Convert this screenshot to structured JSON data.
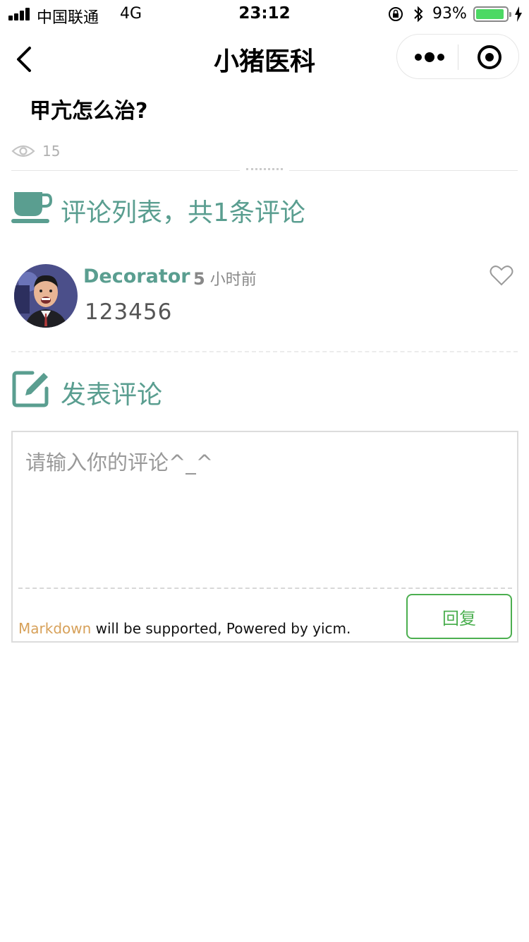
{
  "status_bar": {
    "carrier": "中国联通",
    "network": "4G",
    "time": "23:12",
    "battery_percent_text": "93%",
    "battery_level": 0.93
  },
  "nav": {
    "title": "小猪医科"
  },
  "article": {
    "title": "甲亢怎么治?",
    "view_count": "15"
  },
  "comments": {
    "heading": "评论列表，共1条评论",
    "items": [
      {
        "author": "Decorator",
        "time_number": "5",
        "time_unit": "小时前",
        "text": "123456"
      }
    ]
  },
  "compose": {
    "heading": "发表评论",
    "placeholder": "请输入你的评论^_^",
    "footer_link": "Markdown",
    "footer_text": " will be supported, Powered by yicm.",
    "reply_label": "回复"
  },
  "colors": {
    "accent": "#5a9e90",
    "button_green": "#4caf50",
    "markdown_link": "#d7a15a",
    "battery_fill": "#4cd964"
  },
  "icons": [
    "signal-icon",
    "orientation-lock-icon",
    "bluetooth-icon",
    "battery-icon",
    "charging-icon",
    "back-icon",
    "more-icon",
    "close-miniprogram-icon",
    "eye-icon",
    "coffee-cup-icon",
    "heart-icon",
    "edit-icon"
  ]
}
